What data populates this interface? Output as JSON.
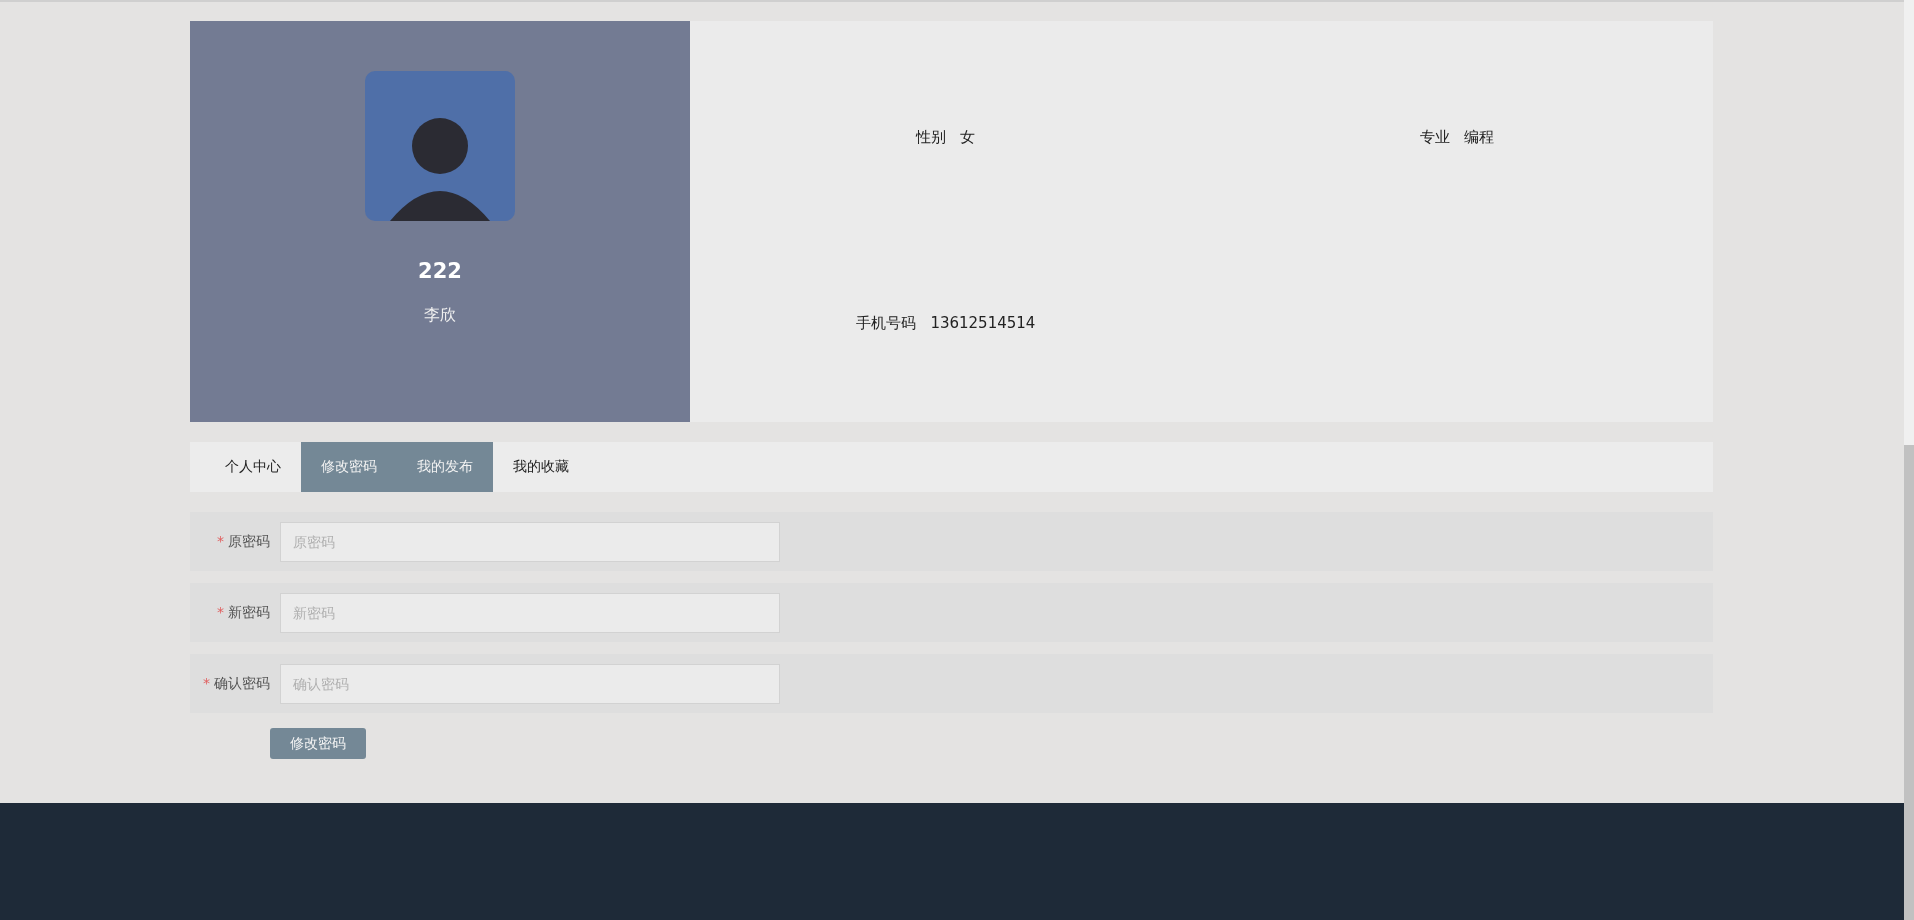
{
  "profile": {
    "username": "222",
    "name": "李欣"
  },
  "info": [
    {
      "label": "性别",
      "value": "女"
    },
    {
      "label": "专业",
      "value": "编程"
    },
    {
      "label": "手机号码",
      "value": "13612514514"
    }
  ],
  "tabs": [
    {
      "label": "个人中心",
      "highlighted": false
    },
    {
      "label": "修改密码",
      "highlighted": true
    },
    {
      "label": "我的发布",
      "highlighted": true
    },
    {
      "label": "我的收藏",
      "highlighted": false
    }
  ],
  "form": {
    "fields": [
      {
        "label": "原密码",
        "placeholder": "原密码",
        "required_mark": "*"
      },
      {
        "label": "新密码",
        "placeholder": "新密码",
        "required_mark": "*"
      },
      {
        "label": "确认密码",
        "placeholder": "确认密码",
        "required_mark": "*"
      }
    ],
    "submit": "修改密码"
  }
}
